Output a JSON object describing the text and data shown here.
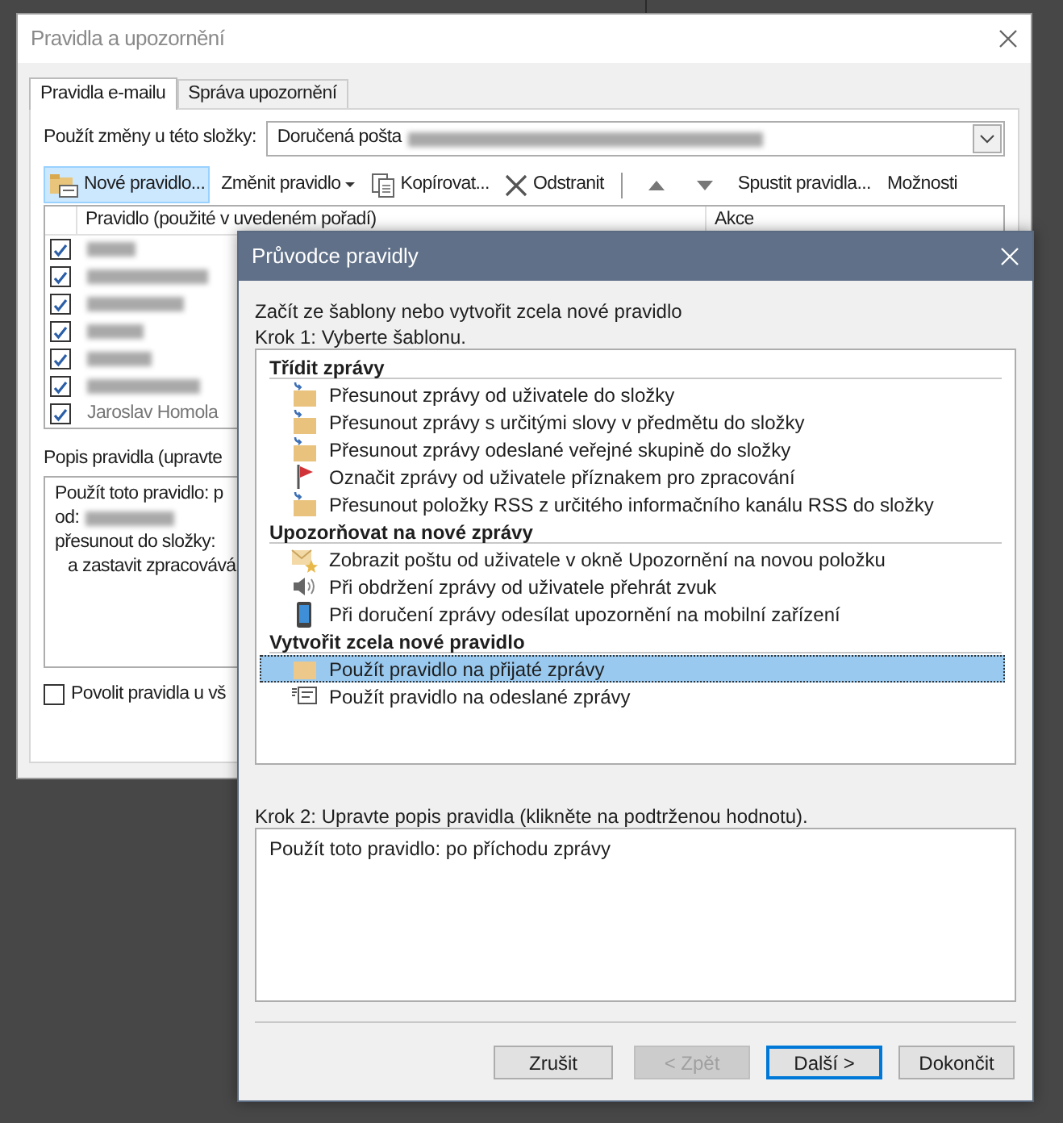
{
  "main_window": {
    "title": "Pravidla a upozornění",
    "tabs": [
      {
        "label": "Pravidla e-mailu",
        "selected": true
      },
      {
        "label": "Správa upozornění",
        "selected": false
      }
    ],
    "folder_label": "Použít změny u této složky:",
    "folder_value": "Doručená pošta",
    "toolbar": [
      {
        "kind": "new",
        "label": "Nové pravidlo...",
        "highlighted": true
      },
      {
        "kind": "menu",
        "label": "Změnit pravidlo",
        "highlighted": false
      },
      {
        "kind": "copy",
        "label": "Kopírovat...",
        "highlighted": false
      },
      {
        "kind": "delete",
        "label": "Odstranit",
        "highlighted": false
      },
      {
        "kind": "separator"
      },
      {
        "kind": "up",
        "highlighted": false
      },
      {
        "kind": "down",
        "highlighted": false
      },
      {
        "kind": "text",
        "label": "Spustit pravidla...",
        "highlighted": false
      },
      {
        "kind": "text",
        "label": "Možnosti",
        "highlighted": false
      }
    ],
    "columns": [
      "Pravidlo (použité v uvedeném pořadí)",
      "Akce"
    ],
    "rules": [
      {
        "checked": true,
        "redacted": true
      },
      {
        "checked": true,
        "redacted": true
      },
      {
        "checked": true,
        "redacted": true
      },
      {
        "checked": true,
        "redacted": true
      },
      {
        "checked": true,
        "redacted": true
      },
      {
        "checked": true,
        "redacted": true
      },
      {
        "checked": true,
        "redacted": false,
        "name": "Jaroslav Homola"
      }
    ],
    "description_label": "Popis pravidla (upravte",
    "description_lines": [
      {
        "text": "Použít toto pravidlo: p",
        "redacted": false
      },
      {
        "text": "od:",
        "redacted": true
      },
      {
        "text": "přesunout do složky:",
        "redacted": false
      },
      {
        "text": "a zastavit zpracovává",
        "redacted": false
      }
    ],
    "enable_all": {
      "label": "Povolit pravidla u vš",
      "checked": false
    }
  },
  "wizard": {
    "title": "Průvodce pravidly",
    "intro": "Začít ze šablony nebo vytvořit zcela nové pravidlo",
    "step1": "Krok 1: Vyberte šablonu.",
    "groups": [
      {
        "heading": "Třídit zprávy",
        "items": [
          {
            "kind": "move",
            "label": "Přesunout zprávy od uživatele do složky",
            "selected": false
          },
          {
            "kind": "move",
            "label": "Přesunout zprávy s určitými slovy v předmětu do složky",
            "selected": false
          },
          {
            "kind": "move",
            "label": "Přesunout zprávy odeslané veřejné skupině do složky",
            "selected": false
          },
          {
            "kind": "flag",
            "label": "Označit zprávy od uživatele příznakem pro zpracování",
            "selected": false
          },
          {
            "kind": "move",
            "label": "Přesunout položky RSS z určitého informačního kanálu RSS do složky",
            "selected": false
          }
        ]
      },
      {
        "heading": "Upozorňovat na nové zprávy",
        "items": [
          {
            "kind": "alert",
            "label": "Zobrazit poštu od uživatele v okně Upozornění na novou položku",
            "selected": false
          },
          {
            "kind": "sound",
            "label": "Při obdržení zprávy od uživatele přehrát zvuk",
            "selected": false
          },
          {
            "kind": "mobile",
            "label": "Při doručení zprávy odesílat upozornění na mobilní zařízení",
            "selected": false
          }
        ]
      },
      {
        "heading": "Vytvořit zcela nové pravidlo",
        "items": [
          {
            "kind": "inbox",
            "label": "Použít pravidlo na přijaté zprávy",
            "selected": true
          },
          {
            "kind": "outbox",
            "label": "Použít pravidlo na odeslané zprávy",
            "selected": false
          }
        ]
      }
    ],
    "step2": "Krok 2: Upravte popis pravidla (klikněte na podtrženou hodnotu).",
    "description": "Použít toto pravidlo: po příchodu zprávy",
    "buttons": [
      {
        "label": "Zrušit",
        "disabled": false,
        "default": false
      },
      {
        "label": "< Zpět",
        "disabled": true,
        "default": false
      },
      {
        "label": "Další >",
        "disabled": false,
        "default": true
      },
      {
        "label": "Dokončit",
        "disabled": false,
        "default": false
      }
    ]
  }
}
